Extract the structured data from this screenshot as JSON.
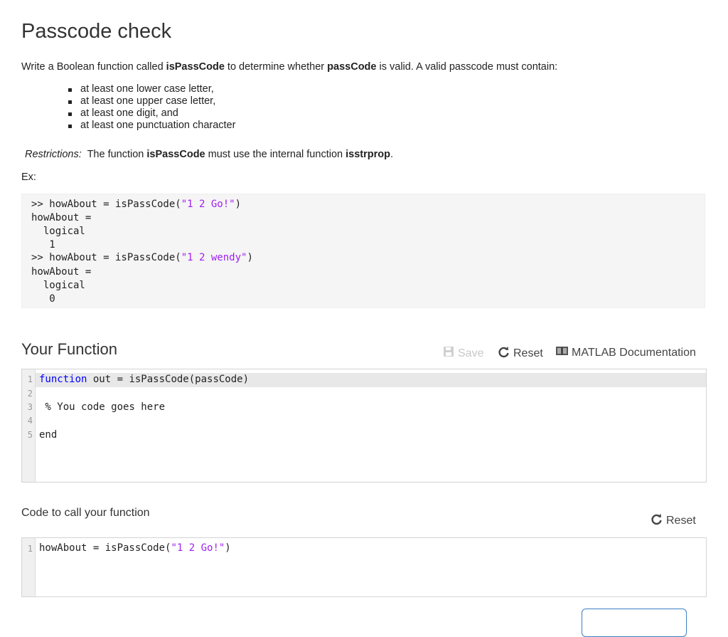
{
  "page": {
    "title": "Passcode check",
    "intro": {
      "text1": "Write a Boolean function called ",
      "bold1": "isPassCode",
      "text2": " to determine whether ",
      "bold2": "passCode",
      "text3": " is valid.  A valid passcode must contain:"
    },
    "requirements": [
      "at least one lower case letter,",
      "at least one upper case letter,",
      "at least one digit, and",
      "at least one punctuation character"
    ],
    "restrictions": {
      "label": "Restrictions:",
      "text1": "  The function ",
      "bold1": "isPassCode",
      "text2": " must use the internal function ",
      "bold2": "isstrprop",
      "text3": "."
    },
    "example_label": "Ex:",
    "example": {
      "line1_prefix": ">> howAbout = isPassCode(",
      "line1_string": "\"1 2 Go!\"",
      "line1_suffix": ")",
      "line2": "howAbout =",
      "line3": "  logical",
      "line4": "   1",
      "line5_prefix": ">> howAbout = isPassCode(",
      "line5_string": "\"1 2 wendy\"",
      "line5_suffix": ")",
      "line6": "howAbout =",
      "line7": "  logical",
      "line8": "   0"
    }
  },
  "function_section": {
    "title": "Your Function",
    "toolbar": {
      "save_label": "Save",
      "reset_label": "Reset",
      "docs_label": "MATLAB Documentation"
    },
    "editor": {
      "line_numbers": [
        "1",
        "2",
        "3",
        "4",
        "5"
      ],
      "line1_keyword": "function",
      "line1_rest": " out = isPassCode(passCode)",
      "line3_comment": " % You code goes here",
      "line5_keyword": "end"
    }
  },
  "call_section": {
    "label": "Code to call your function",
    "reset_label": "Reset",
    "editor": {
      "line_numbers": [
        "1"
      ],
      "line1_prefix": "howAbout = isPassCode(",
      "line1_string": "\"1 2 Go!\"",
      "line1_suffix": ")"
    }
  },
  "colors": {
    "string": "#a020f0",
    "keyword": "#0000ff",
    "comment": "#228b22",
    "button_border": "#3b7fc4"
  }
}
